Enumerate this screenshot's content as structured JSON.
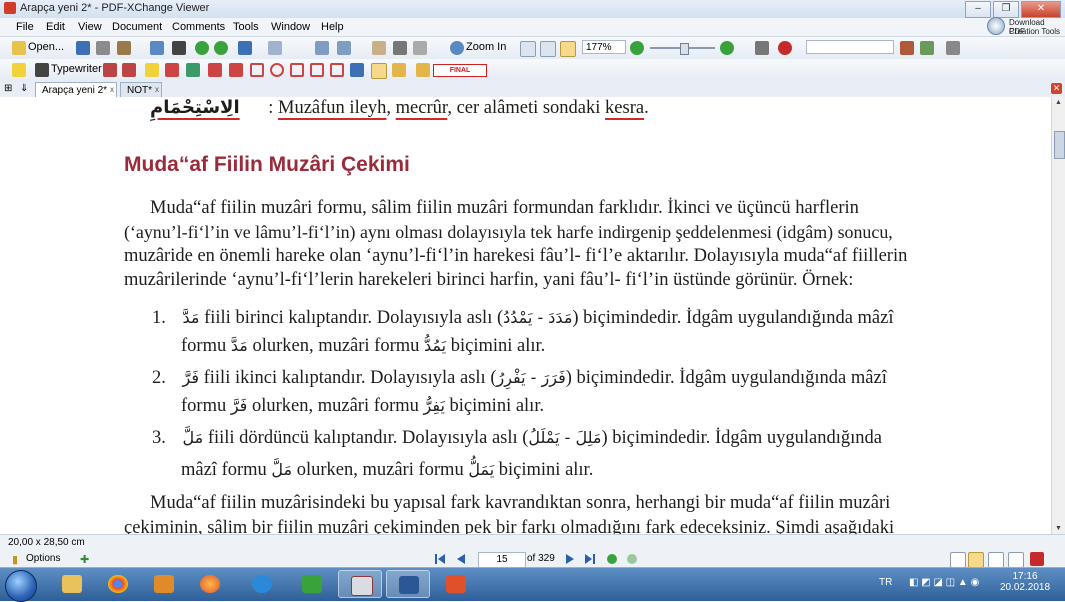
{
  "window": {
    "title": "Arapça yeni 2* - PDF-XChange Viewer",
    "min": "–",
    "max": "❐",
    "close": "✕"
  },
  "menu": [
    "File",
    "Edit",
    "View",
    "Document",
    "Comments",
    "Tools",
    "Window",
    "Help"
  ],
  "download_pdf": {
    "line1": "Download PDF",
    "line2": "Creation Tools"
  },
  "toolbar1": {
    "open_label": "Open...",
    "zoom_in_label": "Zoom In",
    "zoom_value": "177%",
    "search_value": ""
  },
  "toolbar2": {
    "typewriter_label": "Typewriter",
    "stamp_label": "FINAL"
  },
  "tabs": [
    {
      "label": "Arapça yeni 2*",
      "close": "x"
    },
    {
      "label": "NOT*",
      "close": "x"
    }
  ],
  "document": {
    "top_line": {
      "arabic": "الِاسْتِحْمَامِ",
      "prefix": ": ",
      "t1": "Muzâfun ileyh",
      "sep1": ", ",
      "t2": "mecrûr",
      "sep2": ", cer alâmeti sondaki ",
      "t3": "kesra",
      "end": "."
    },
    "heading": "Muda“af Fiilin Muzâri Çekimi",
    "para1": [
      "Muda“af fiilin muzâri formu, sâlim fiilin muzâri formundan farklıdır. İkinci ve üçüncü harflerin",
      "(‘aynu’l-fi‘l’in ve lâmu’l-fi‘l’in) aynı olması dolayısıyla tek harfe indirgenip şeddelenmesi (idgâm) sonucu,",
      "muzâride en önemli hareke olan ‘aynu’l-fi‘l’in harekesi fâu’l- fi‘l’e aktarılır. Dolayısıyla muda“af fiillerin",
      "muzârilerinde ‘aynu’l-fi‘l’lerin harekeleri birinci harfin, yani fâu’l- fi‘l’in üstünde görünür. Örnek:"
    ],
    "items": [
      {
        "num": "1.",
        "l1a": "مَدَّ",
        "l1b": "fiili birinci kalıptandır. Dolayısıyla aslı (",
        "l1c": "مَدَدَ - يَمْدُدُ",
        "l1d": ") biçimindedir. İdgâm uygulandığında mâzî",
        "l2a": "formu ",
        "l2b": "مَدَّ",
        "l2c": " olurken, muzâri formu ",
        "l2d": "يَمُدُّ",
        "l2e": " biçimini alır."
      },
      {
        "num": "2.",
        "l1a": "فَرَّ",
        "l1b": "fiili ikinci kalıptandır. Dolayısıyla aslı (",
        "l1c": "فَرَرَ - يَفْرِرُ",
        "l1d": ") biçimindedir. İdgâm uygulandığında mâzî",
        "l2a": "formu ",
        "l2b": "فَرَّ",
        "l2c": " olurken, muzâri formu ",
        "l2d": "يَفِرُّ",
        "l2e": " biçimini alır."
      },
      {
        "num": "3.",
        "l1a": "مَلَّ",
        "l1b": "fiili dördüncü kalıptandır. Dolayısıyla aslı (",
        "l1c": "مَلِلَ - يَمْلَلُ",
        "l1d": ") biçimindedir. İdgâm uygulandığında",
        "l2a": "mâzî formu ",
        "l2b": "مَلَّ",
        "l2c": " olurken, muzâri formu ",
        "l2d": "يَمَلُّ",
        "l2e": " biçimini alır."
      }
    ],
    "para2": [
      "Muda“af fiilin muzârisindeki bu yapısal fark kavrandıktan sonra, herhangi bir muda“af fiilin muzâri",
      "çekiminin, sâlim bir fiilin muzâri çekiminden pek bir farkı olmadığını fark edeceksiniz. Şimdi aşağıdaki"
    ]
  },
  "statusbar": {
    "dimensions": "20,00 x 28,50 cm",
    "options": "Options",
    "page_current": "15",
    "page_of": "of 329"
  },
  "taskbar": {
    "lang": "TR",
    "time": "17:16",
    "date": "20.02.2018"
  },
  "colors": {
    "heading": "#9a2b3a",
    "underline": "#cc2b2b",
    "taskbar": "#2f5f98"
  }
}
